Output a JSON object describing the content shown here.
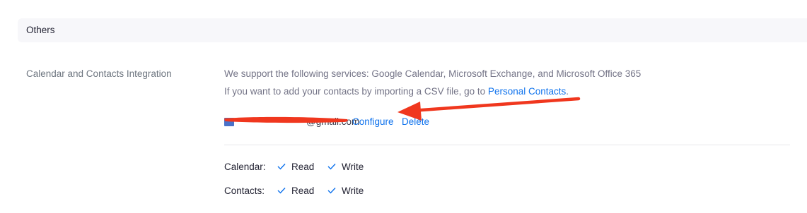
{
  "section": {
    "title": "Others"
  },
  "setting": {
    "label": "Calendar and Contacts Integration",
    "supported_text": "We support the following services: Google Calendar, Microsoft Exchange, and Microsoft Office 365",
    "csv_prefix": "If you want to add your contacts by importing a CSV file, go to ",
    "csv_link": "Personal Contacts",
    "csv_suffix": "."
  },
  "account": {
    "email_visible": "@gmail.com",
    "configure_label": "Configure",
    "delete_label": "Delete"
  },
  "permissions": [
    {
      "label": "Calendar:",
      "read": "Read",
      "write": "Write"
    },
    {
      "label": "Contacts:",
      "read": "Read",
      "write": "Write"
    }
  ],
  "colors": {
    "link": "#0e72ed",
    "annotation_red": "#f0371e",
    "check": "#0e72ed"
  }
}
